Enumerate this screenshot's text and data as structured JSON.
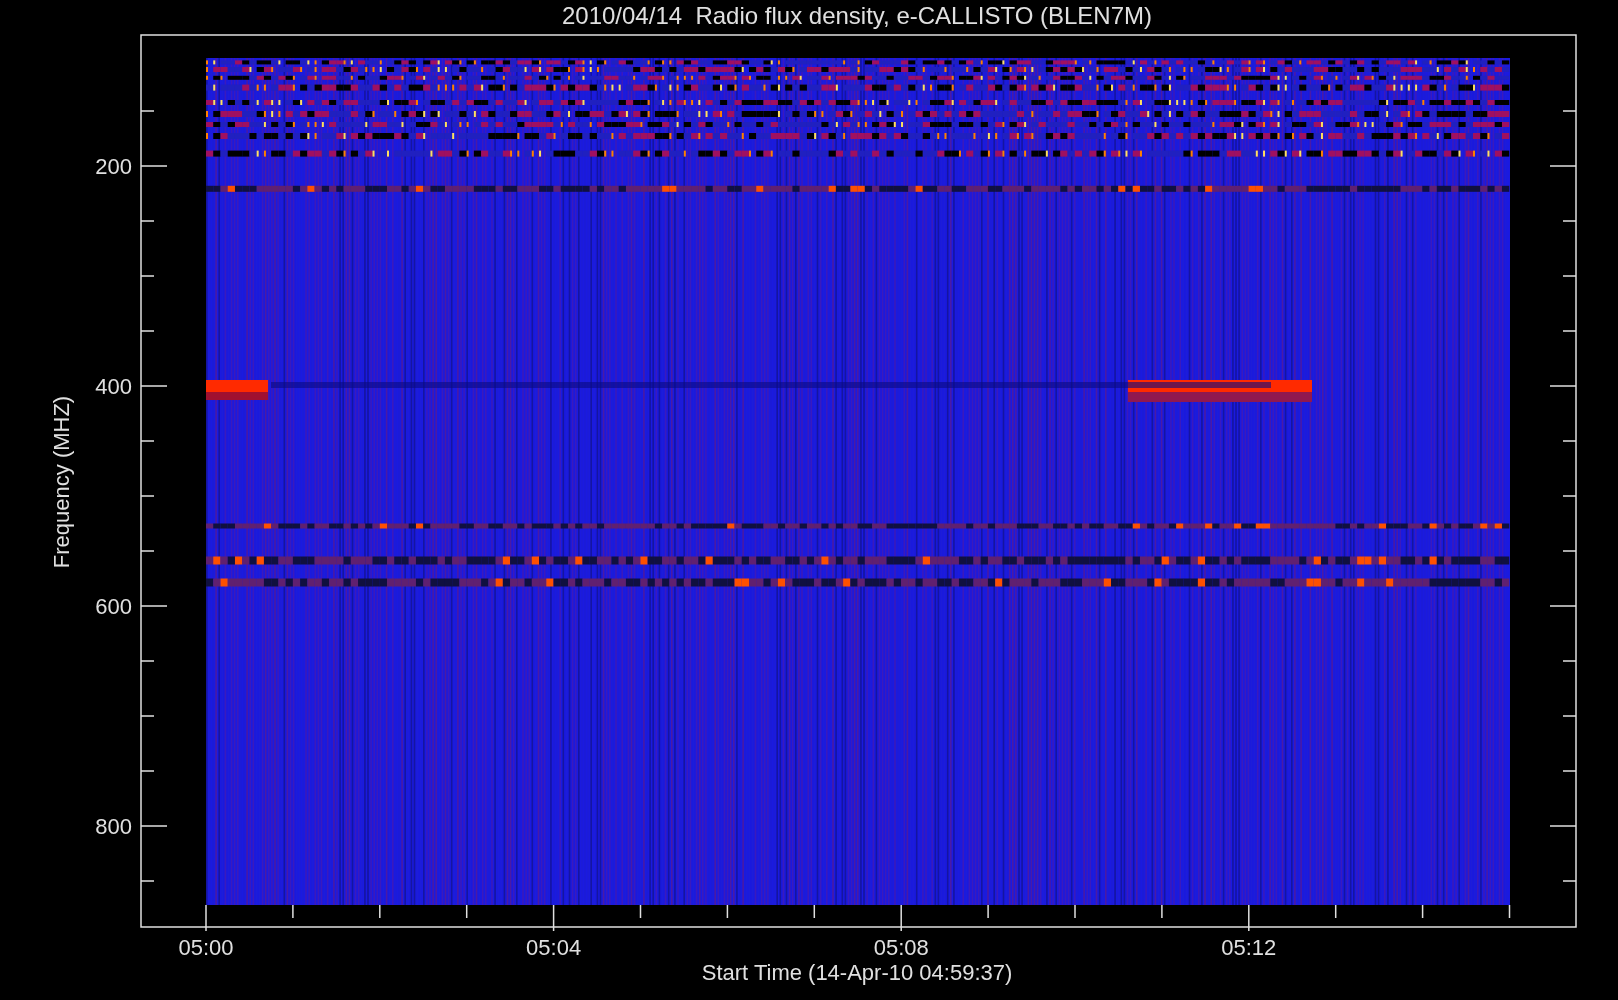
{
  "title": "2010/04/14  Radio flux density, e-CALLISTO (BLEN7M)",
  "y_axis": {
    "label": "Frequency (MHZ)",
    "ticks": [
      "200",
      "400",
      "600",
      "800"
    ]
  },
  "x_axis": {
    "label": "Start Time (14-Apr-10 04:59:37)",
    "ticks": [
      "05:00",
      "05:04",
      "05:08",
      "05:12"
    ]
  }
}
